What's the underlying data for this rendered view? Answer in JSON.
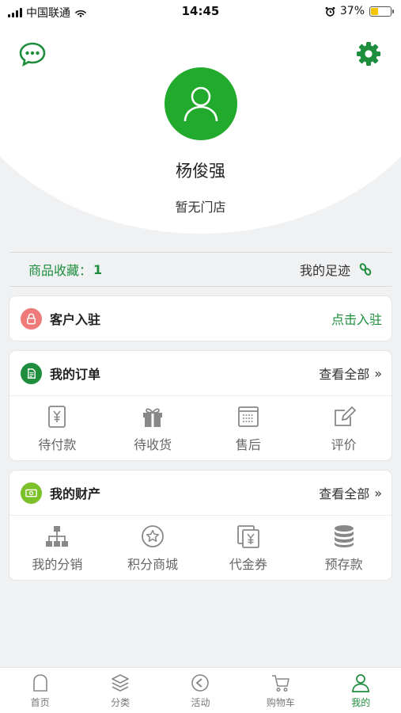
{
  "status_bar": {
    "carrier": "中国联通",
    "time": "14:45",
    "battery_pct": "37%",
    "battery_level": 0.37
  },
  "profile": {
    "name": "杨俊强",
    "store": "暂无门店"
  },
  "stats": {
    "favorites_label": "商品收藏：",
    "favorites_count": "1",
    "footprint_label": "我的足迹"
  },
  "customer": {
    "title": "客户入驻",
    "action": "点击入驻"
  },
  "orders": {
    "title": "我的订单",
    "view_all": "查看全部",
    "items": [
      {
        "label": "待付款",
        "icon": "yen-wallet-icon"
      },
      {
        "label": "待收货",
        "icon": "gift-icon"
      },
      {
        "label": "售后",
        "icon": "receipt-icon"
      },
      {
        "label": "评价",
        "icon": "edit-icon"
      }
    ]
  },
  "assets": {
    "title": "我的财产",
    "view_all": "查看全部",
    "items": [
      {
        "label": "我的分销",
        "icon": "hierarchy-icon"
      },
      {
        "label": "积分商城",
        "icon": "star-icon"
      },
      {
        "label": "代金券",
        "icon": "voucher-icon"
      },
      {
        "label": "预存款",
        "icon": "coins-stack-icon"
      }
    ]
  },
  "tabs": [
    {
      "label": "首页",
      "icon": "home-icon"
    },
    {
      "label": "分类",
      "icon": "layers-icon"
    },
    {
      "label": "活动",
      "icon": "activity-icon"
    },
    {
      "label": "购物车",
      "icon": "cart-icon"
    },
    {
      "label": "我的",
      "icon": "user-icon",
      "active": true
    }
  ],
  "colors": {
    "accent": "#1e8e3e",
    "avatar_bg": "#21aa2b",
    "customer_icon": "#ee7a7a",
    "assets_icon": "#7cc02a",
    "background": "#f0f1f3"
  }
}
